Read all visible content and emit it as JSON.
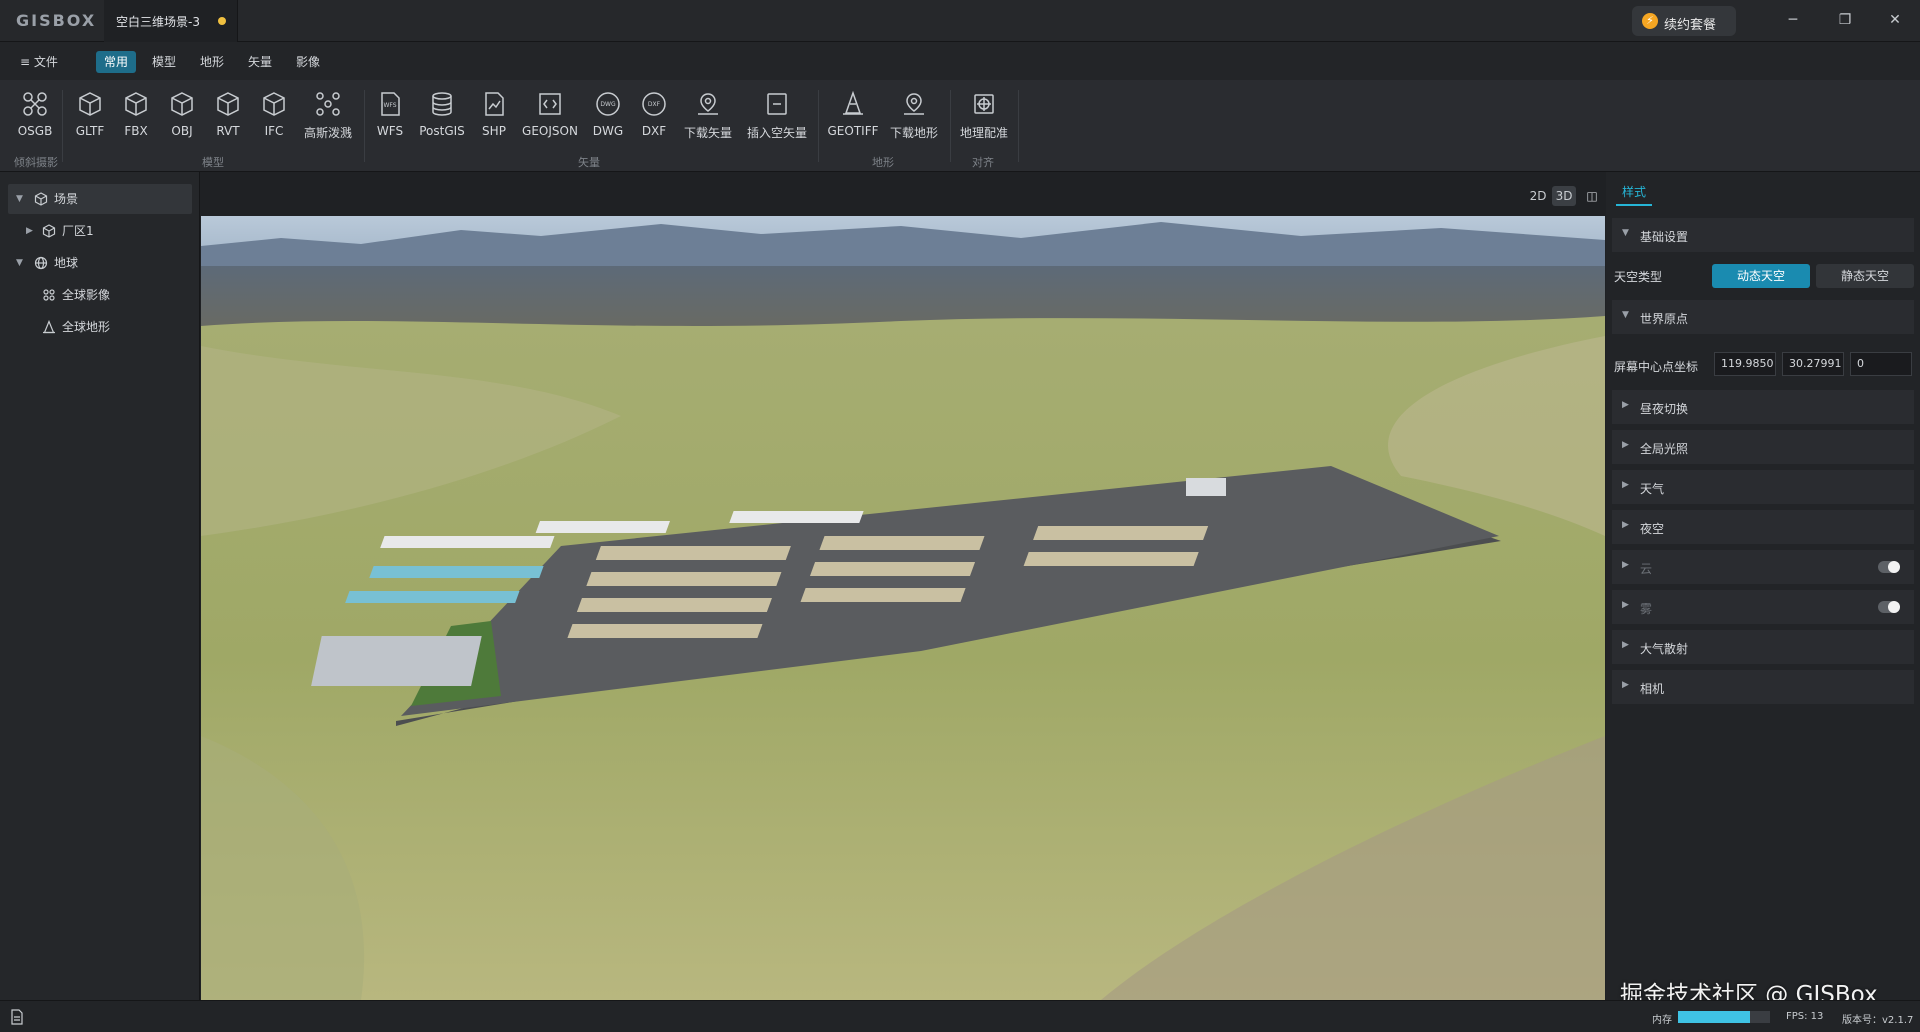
{
  "app": {
    "logo_text": "GISBOX",
    "document_tab": "空白三维场景-3",
    "renew_button": "续约套餐",
    "window_controls": {
      "minimize": "─",
      "maximize": "❐",
      "close": "✕"
    }
  },
  "menu": {
    "file": "≡ 文件",
    "tabs": [
      {
        "label": "常用",
        "active": true
      },
      {
        "label": "模型",
        "active": false
      },
      {
        "label": "地形",
        "active": false
      },
      {
        "label": "矢量",
        "active": false
      },
      {
        "label": "影像",
        "active": false
      }
    ]
  },
  "ribbon": {
    "tools": [
      {
        "label": "OSGB",
        "icon": "drone-icon"
      },
      {
        "label": "GLTF",
        "icon": "cube-icon"
      },
      {
        "label": "FBX",
        "icon": "cube-icon"
      },
      {
        "label": "OBJ",
        "icon": "cube-icon"
      },
      {
        "label": "RVT",
        "icon": "cube-icon"
      },
      {
        "label": "IFC",
        "icon": "cube-icon"
      },
      {
        "label": "高斯泼溅",
        "icon": "gaussian-splat-icon"
      },
      {
        "label": "WFS",
        "icon": "wfs-file-icon"
      },
      {
        "label": "PostGIS",
        "icon": "database-icon"
      },
      {
        "label": "SHP",
        "icon": "shp-file-icon"
      },
      {
        "label": "GEOJSON",
        "icon": "geojson-file-icon"
      },
      {
        "label": "DWG",
        "icon": "dwg-icon"
      },
      {
        "label": "DXF",
        "icon": "dxf-icon"
      },
      {
        "label": "下载矢量",
        "icon": "download-vector-icon"
      },
      {
        "label": "插入空矢量",
        "icon": "insert-vector-icon"
      },
      {
        "label": "GEOTIFF",
        "icon": "geotiff-icon"
      },
      {
        "label": "下载地形",
        "icon": "download-terrain-icon"
      },
      {
        "label": "地理配准",
        "icon": "georeference-icon"
      }
    ],
    "groups": [
      "倾斜摄影",
      "模型",
      "矢量",
      "地形",
      "对齐"
    ]
  },
  "tree": {
    "items": [
      {
        "label": "场景",
        "arrow": "▼",
        "icon": "scene-icon"
      },
      {
        "label": "厂区1",
        "arrow": "▶",
        "icon": "model-icon"
      },
      {
        "label": "地球",
        "arrow": "▼",
        "icon": "globe-icon"
      },
      {
        "label": "全球影像",
        "arrow": "",
        "icon": "imagery-icon"
      },
      {
        "label": "全球地形",
        "arrow": "",
        "icon": "terrain-icon"
      }
    ]
  },
  "view_modes": [
    "2D",
    "3D",
    "◫"
  ],
  "panel": {
    "tab": "样式",
    "basic_settings": "基础设置",
    "sky_type_label": "天空类型",
    "sky_dynamic": "动态天空",
    "sky_static": "静态天空",
    "world_origin": "世界原点",
    "screen_center_label": "屏幕中心点坐标",
    "coord_lon": "119.9850",
    "coord_lat": "30.27991",
    "coord_alt": "0",
    "sections": [
      {
        "label": "昼夜切换",
        "has_toggle": false,
        "dim": false
      },
      {
        "label": "全局光照",
        "has_toggle": false,
        "dim": false
      },
      {
        "label": "天气",
        "has_toggle": false,
        "dim": false
      },
      {
        "label": "夜空",
        "has_toggle": false,
        "dim": false
      },
      {
        "label": "云",
        "has_toggle": true,
        "dim": true
      },
      {
        "label": "雾",
        "has_toggle": true,
        "dim": true
      },
      {
        "label": "大气散射",
        "has_toggle": false,
        "dim": false
      },
      {
        "label": "相机",
        "has_toggle": false,
        "dim": false
      }
    ]
  },
  "status": {
    "memory_label": "内存",
    "memory_fraction": 0.78,
    "fps": "FPS: 13",
    "version": "版本号：v2.1.7"
  },
  "watermark": "掘金技术社区 @ GISBox",
  "colors": {
    "accent": "#26b5d6",
    "active_tab": "#1e6d8a",
    "renew_icon": "#f5a623",
    "unsaved_dot": "#f0c040"
  }
}
